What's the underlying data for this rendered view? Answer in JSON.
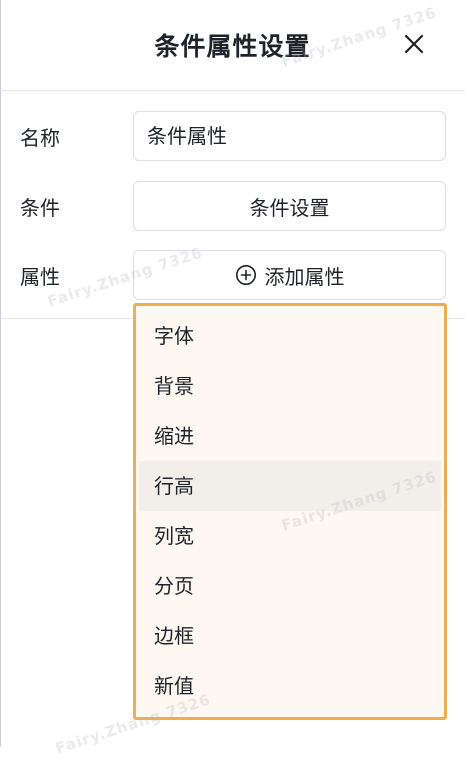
{
  "dialog": {
    "title": "条件属性设置",
    "close_icon": "close-icon"
  },
  "form": {
    "name_label": "名称",
    "name_value": "条件属性",
    "condition_label": "条件",
    "condition_button": "条件设置",
    "attribute_label": "属性",
    "add_attribute_button": "添加属性",
    "add_icon": "plus-circle-icon"
  },
  "dropdown": {
    "hovered_item": "行高",
    "items": [
      "字体",
      "背景",
      "缩进",
      "行高",
      "列宽",
      "分页",
      "边框",
      "新值"
    ]
  },
  "watermark": {
    "text": "Fairy.Zhang 7326"
  },
  "colors": {
    "dropdown_border": "#f0ad4e",
    "dropdown_background": "#fdf8f1",
    "hover_background": "#f2efea",
    "input_border": "#dcdfe6"
  }
}
